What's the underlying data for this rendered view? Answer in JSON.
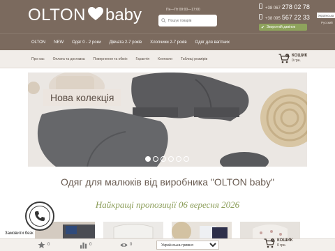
{
  "header": {
    "logo_left": "OLTON",
    "logo_right": "baby",
    "work_hours": "Пн—Пт 09:00—17:00",
    "search_placeholder": "Пошук товарів",
    "phone1_code": "+38 067",
    "phone1_number": "278 02 78",
    "phone2_code": "+38 095",
    "phone2_number": "567 22 33",
    "callback_label": "Зворотній дзвінок",
    "lang_active": "Українська",
    "lang_other": "Русский"
  },
  "main_nav": [
    "OLTON",
    "NEW",
    "Одяг 0 - 2 роки",
    "Дівчата 2-7 років",
    "Хлопчики 2-7 років",
    "Одяг для вагітних"
  ],
  "sub_nav": [
    "Про нас",
    "Оплата та доставка",
    "Повернення та обмін",
    "Гарантія",
    "Контакти",
    "Таблиці розмірів"
  ],
  "cart": {
    "label": "КОШИК",
    "total": "0 грн.",
    "count": "0"
  },
  "banner": {
    "label": "Нова колекція",
    "active_slide": 0,
    "slide_count": 6
  },
  "main_title": "Одяг для малюків від виробника \"OLTON baby\"",
  "promo_title": "Найкращі пропозиції 06 вересня 2026",
  "help_text": "Замовити безк",
  "bottom_bar": {
    "favorites_count": "0",
    "compare_count": "0",
    "viewed_count": "0",
    "currency": "Українська гривня",
    "cart_total": "0 грн.",
    "cart_count": "0"
  },
  "colors": {
    "brand": "#7b6a5e",
    "accent_green": "#8ea35c"
  },
  "icons": [
    "heart-icon",
    "search-icon",
    "phone-icon",
    "check-icon",
    "cart-icon",
    "star-icon",
    "bar-chart-icon",
    "eye-icon",
    "telephone-icon"
  ]
}
